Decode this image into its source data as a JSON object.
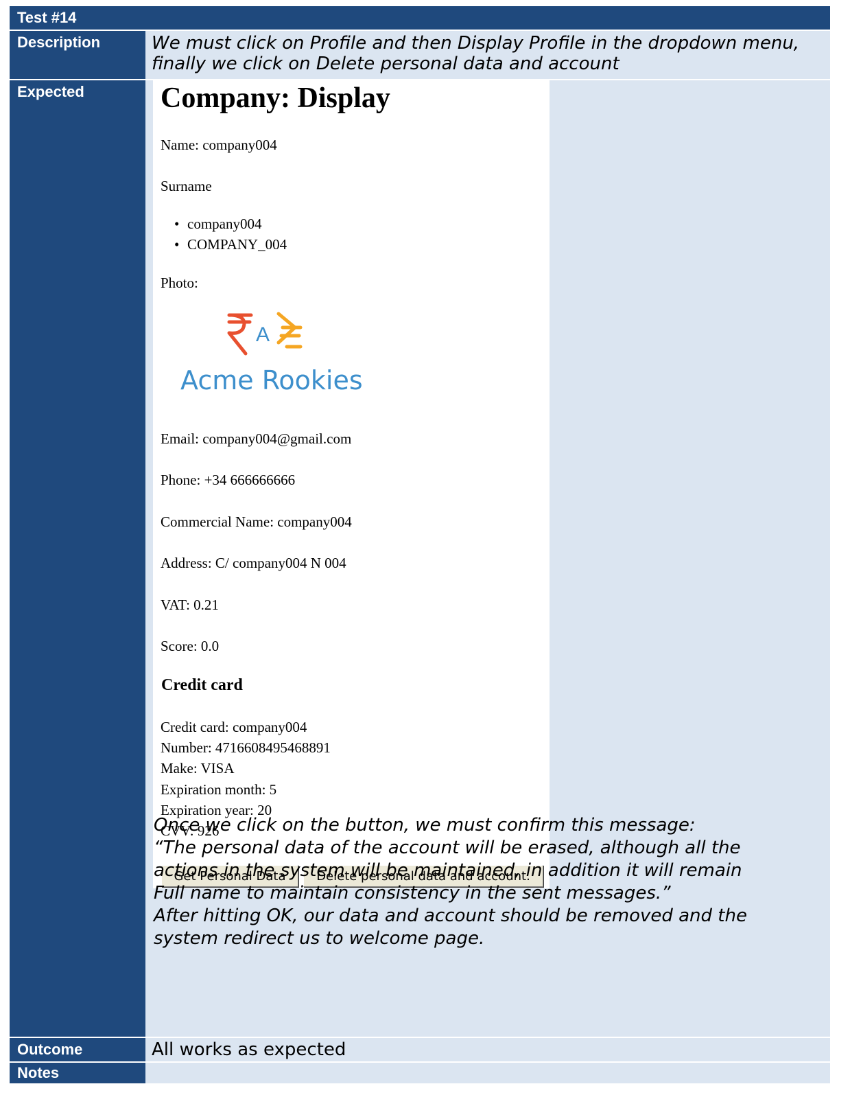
{
  "test": {
    "title": "Test #14"
  },
  "labels": {
    "description": "Description",
    "expected": "Expected",
    "outcome": "Outcome",
    "notes": "Notes"
  },
  "description": {
    "text": "We must click on Profile and then Display Profile in the dropdown menu, finally we click on Delete personal data and account"
  },
  "screenshot": {
    "heading": "Company: Display",
    "name": "Name: company004",
    "surname": "Surname",
    "surname_items": [
      "company004",
      "COMPANY_004"
    ],
    "photo": "Photo:",
    "logo": {
      "symbol": "A",
      "text": "Acme Rookies",
      "colors": {
        "red": "#e8502f",
        "orange": "#f5a623",
        "blue": "#3d8fcc"
      }
    },
    "email": "Email: company004@gmail.com",
    "phone": "Phone: +34 666666666",
    "commercial_name": "Commercial Name: company004",
    "address": "Address: C/ company004 N 004",
    "vat": "VAT: 0.21",
    "score": "Score: 0.0",
    "credit_heading": "Credit card",
    "credit_lines": [
      "Credit card: company004",
      "Number: 4716608495468891",
      "Make: VISA",
      "Expiration month: 5",
      "Expiration year: 20",
      "CVV: 926"
    ],
    "buttons": {
      "get": "Get Personal Data",
      "delete": "Delete personal data and account."
    }
  },
  "expected_text": {
    "lines": [
      "Once we click on the button, we must confirm this message:",
      "“The personal data of the account will be erased, although all the",
      "actions in the system will be maintained, in addition it will remain",
      "Full name to maintain consistency in the sent messages.”",
      "After hitting OK, our data and account should be removed and the",
      "system redirect us to welcome page."
    ]
  },
  "outcome": {
    "text": "All works as expected"
  },
  "notes": {
    "text": ""
  },
  "colors": {
    "header": "#1f497d",
    "cell": "#dbe5f1"
  }
}
